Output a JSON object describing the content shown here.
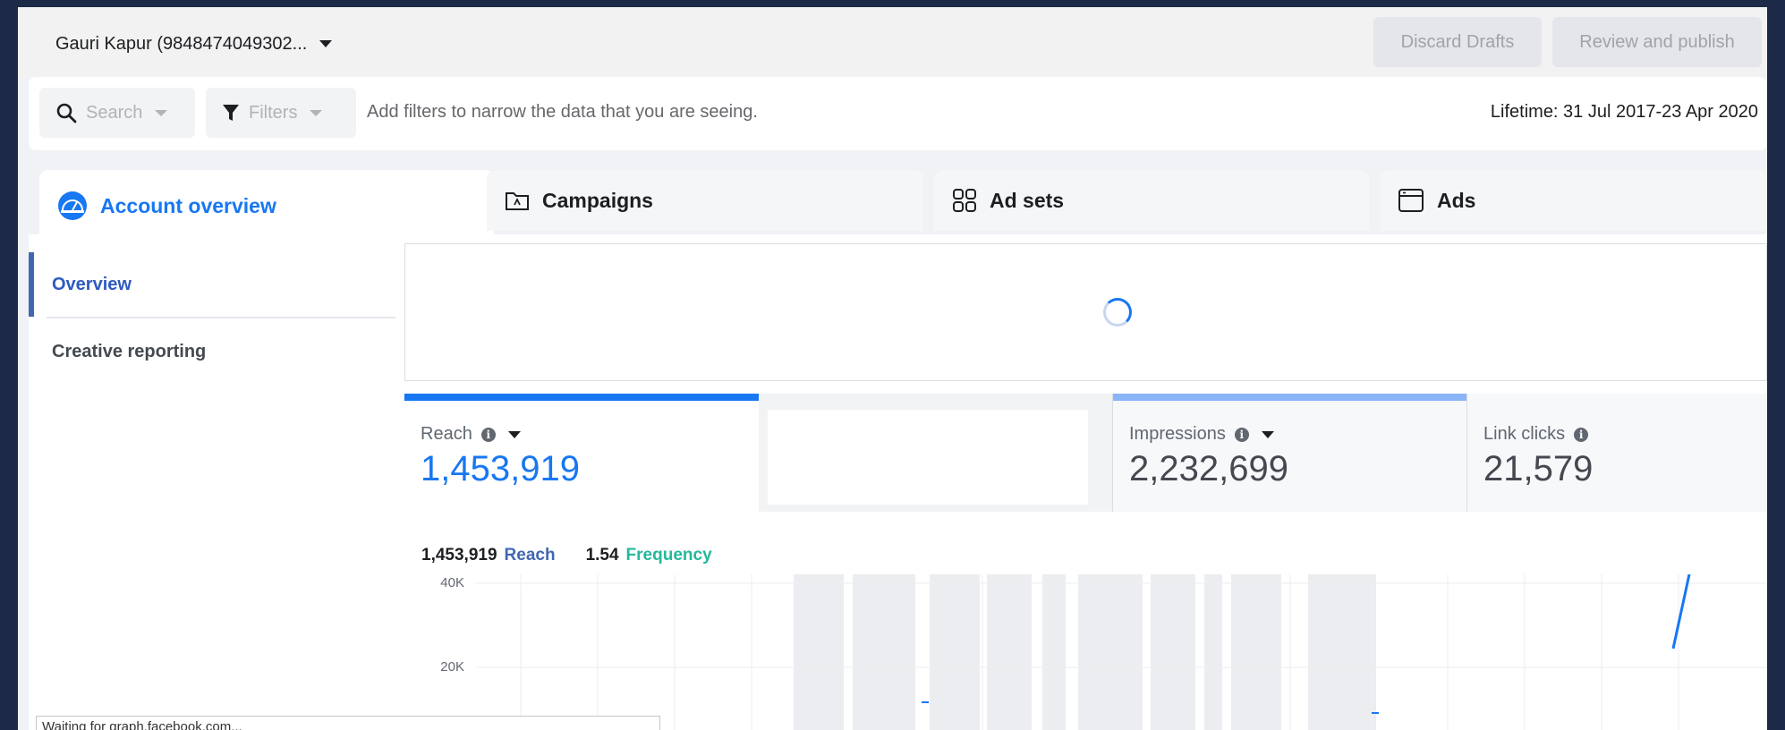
{
  "topbar": {
    "account_name": "Gauri Kapur (9848474049302...",
    "discard_label": "Discard Drafts",
    "review_label": "Review and publish"
  },
  "filterbar": {
    "search_label": "Search",
    "filters_label": "Filters",
    "hint": "Add filters to narrow the data that you are seeing.",
    "date_range": "Lifetime: 31 Jul 2017-23 Apr 2020"
  },
  "tabs": [
    {
      "label": "Account overview",
      "icon": "dashboard-icon"
    },
    {
      "label": "Campaigns",
      "icon": "folder-icon"
    },
    {
      "label": "Ad sets",
      "icon": "grid-icon"
    },
    {
      "label": "Ads",
      "icon": "window-icon"
    }
  ],
  "sidenav": {
    "items": [
      {
        "label": "Overview"
      },
      {
        "label": "Creative reporting"
      }
    ]
  },
  "metrics": [
    {
      "label": "Reach",
      "value": "1,453,919"
    },
    {
      "label": "Impressions",
      "value": "2,232,699"
    },
    {
      "label": "Link clicks",
      "value": "21,579"
    }
  ],
  "legend": {
    "reach_value": "1,453,919",
    "reach_label": "Reach",
    "frequency_value": "1.54",
    "frequency_label": "Frequency"
  },
  "chart_data": {
    "type": "bar",
    "yticks": [
      "40K",
      "20K"
    ],
    "ylim": [
      0,
      40000
    ],
    "grid": true
  },
  "colors": {
    "accent": "#1877f2",
    "reach": "#4267b2",
    "frequency": "#24b89b",
    "impressions_bar": "#8ab4f8",
    "background": "#1c2a47"
  },
  "status": {
    "text": "Waiting for graph.facebook.com..."
  }
}
